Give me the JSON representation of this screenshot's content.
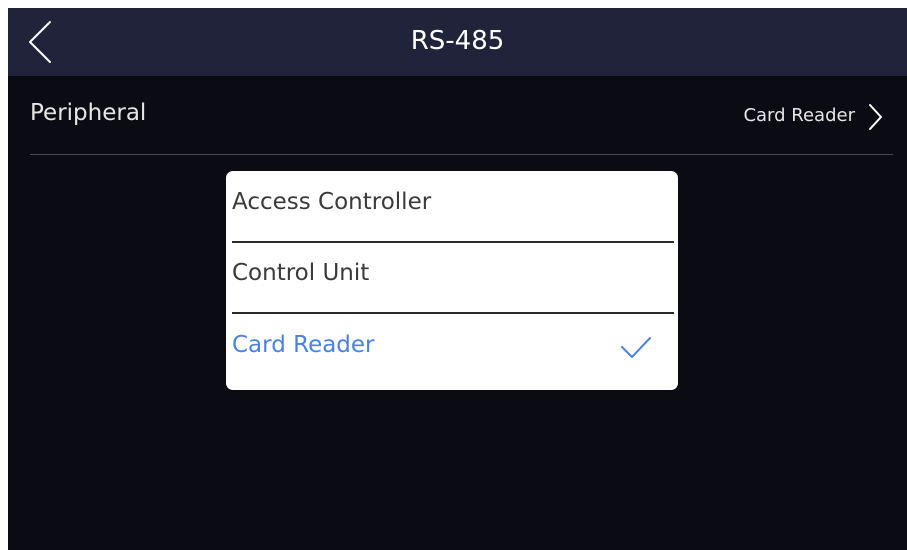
{
  "header": {
    "title": "RS-485",
    "back_icon": "chevron-left-icon"
  },
  "settings": {
    "peripheral": {
      "label": "Peripheral",
      "value": "Card Reader",
      "chevron_icon": "chevron-right-icon"
    }
  },
  "dialog": {
    "options": [
      {
        "label": "Access Controller",
        "selected": false
      },
      {
        "label": "Control Unit",
        "selected": false
      },
      {
        "label": "Card Reader",
        "selected": true
      }
    ],
    "selected_icon": "checkmark-icon"
  },
  "colors": {
    "header_bg": "#21233a",
    "screen_bg": "#0b0b13",
    "accent": "#4a82e0"
  }
}
